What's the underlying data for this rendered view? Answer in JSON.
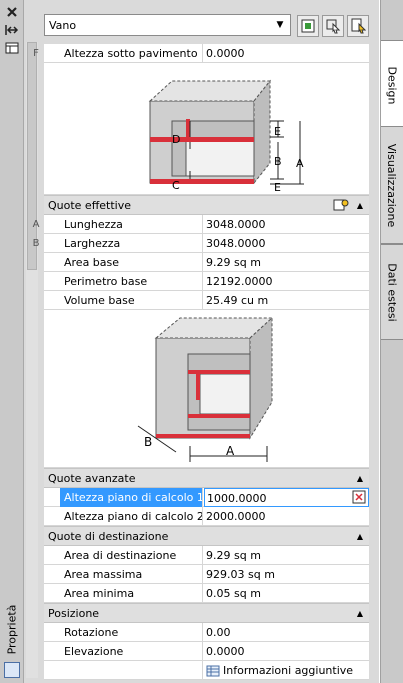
{
  "panel": {
    "title": "Proprietà",
    "close_icon": "close-icon",
    "autohide_icon": "autohide-icon",
    "properties_icon": "properties-icon"
  },
  "top": {
    "type_select": {
      "value": "Vano"
    },
    "buttons": [
      {
        "name": "select-objects-icon"
      },
      {
        "name": "quick-select-icon"
      },
      {
        "name": "toggle-pickadd-icon"
      }
    ]
  },
  "tabs": [
    {
      "label": "Design",
      "active": true
    },
    {
      "label": "Visualizzazione",
      "active": false
    },
    {
      "label": "Dati estesi",
      "active": false
    }
  ],
  "grid": {
    "row_pav": {
      "marker": "F",
      "label": "Altezza sotto pavimento",
      "value": "0.0000"
    },
    "fig1_labels": {
      "d": "D",
      "e_top": "E",
      "b": "B",
      "a": "A",
      "c": "C",
      "e_bottom": "E"
    },
    "sec_quote_eff": {
      "title": "Quote effettive"
    },
    "row_lung": {
      "marker": "A",
      "label": "Lunghezza",
      "value": "3048.0000"
    },
    "row_larg": {
      "marker": "B",
      "label": "Larghezza",
      "value": "3048.0000"
    },
    "row_area": {
      "label": "Area base",
      "value": "9.29 sq m"
    },
    "row_perim": {
      "label": "Perimetro base",
      "value": "12192.0000"
    },
    "row_vol": {
      "label": "Volume base",
      "value": "25.49  cu m"
    },
    "fig2_labels": {
      "b": "B",
      "a": "A"
    },
    "sec_quote_av": {
      "title": "Quote avanzate"
    },
    "row_alt1": {
      "label": "Altezza piano di calcolo 1",
      "value": "1000.0000"
    },
    "row_alt2": {
      "label": "Altezza piano di calcolo 2",
      "value": "2000.0000"
    },
    "sec_quote_dest": {
      "title": "Quote di destinazione"
    },
    "row_area_dest": {
      "label": "Area di destinazione",
      "value": "9.29 sq m"
    },
    "row_area_max": {
      "label": "Area massima",
      "value": "929.03 sq m"
    },
    "row_area_min": {
      "label": "Area minima",
      "value": "0.05 sq m"
    },
    "sec_pos": {
      "title": "Posizione"
    },
    "row_rot": {
      "label": "Rotazione",
      "value": "0.00"
    },
    "row_elev": {
      "label": "Elevazione",
      "value": "0.0000"
    },
    "row_info": {
      "label": "Informazioni aggiuntive"
    }
  },
  "colors": {
    "selection": "#3399ff",
    "section_bg": "#dfdfdf",
    "accent_red": "#d9303a"
  }
}
